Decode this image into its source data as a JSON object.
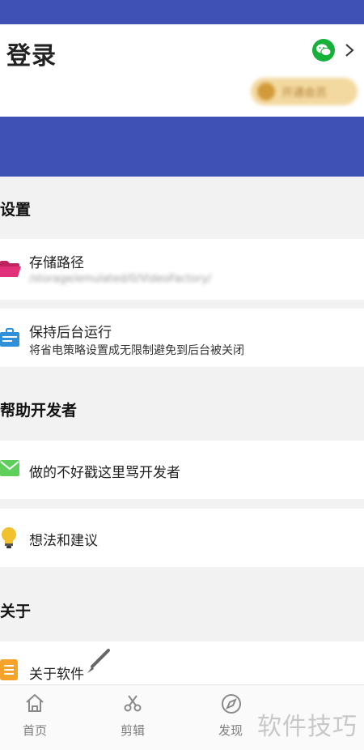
{
  "header": {
    "login_title": "登录",
    "vip_button_label": "开通会员"
  },
  "settings": {
    "section_title": "设置",
    "storage": {
      "title": "存储路径",
      "path": "/storage/emulated/0/VideoFactory/"
    },
    "keep_alive": {
      "title": "保持后台运行",
      "subtitle": "将省电策略设置成无限制避免到后台被关闭"
    }
  },
  "help": {
    "section_title": "帮助开发者",
    "feedback": {
      "title": "做的不好戳这里骂开发者"
    },
    "ideas": {
      "title": "想法和建议"
    }
  },
  "about": {
    "section_title": "关于",
    "about_software": {
      "title": "关于软件"
    }
  },
  "bottom_nav": {
    "items": [
      {
        "label": "首页",
        "icon": "home-icon"
      },
      {
        "label": "剪辑",
        "icon": "scissors-icon"
      },
      {
        "label": "发现",
        "icon": "compass-icon"
      }
    ]
  },
  "watermark": "软件技巧",
  "colors": {
    "header_bg": "#3f51b5",
    "wechat_green": "#16b13a",
    "folder_pink": "#e0307a",
    "briefcase_blue": "#2f8fd8",
    "mail_green": "#5fcf5b",
    "bulb_yellow": "#f2c12e",
    "doc_orange": "#f5a32a"
  }
}
